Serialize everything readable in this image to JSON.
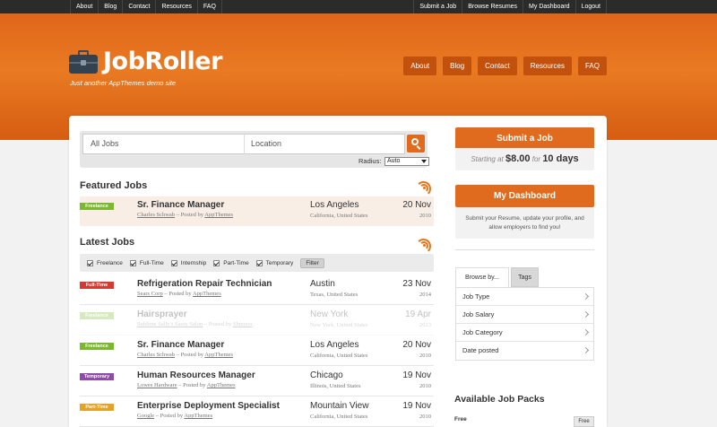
{
  "topbar": {
    "left_links": [
      "About",
      "Blog",
      "Contact",
      "Resources",
      "FAQ"
    ],
    "right_links": [
      "Submit a Job",
      "Browse Resumes",
      "My Dashboard",
      "Logout"
    ]
  },
  "header": {
    "logo_text": "JobRoller",
    "tagline": "Just another AppThemes demo site",
    "nav": [
      "About",
      "Blog",
      "Contact",
      "Resources",
      "FAQ"
    ]
  },
  "search": {
    "jobs_placeholder": "All Jobs",
    "location_placeholder": "Location",
    "radius_label": "Radius:",
    "radius_value": "Auto"
  },
  "featured": {
    "title": "Featured Jobs",
    "jobs": [
      {
        "badge": "Freelance",
        "badge_color": "#7cb82f",
        "title": "Sr. Finance Manager",
        "company": "Charles Schwab",
        "posted_prefix": " – Posted by ",
        "poster": "AppThemes",
        "location": "Los Angeles",
        "region": "California, United States",
        "date": "20 Nov",
        "year": "2010"
      }
    ]
  },
  "latest": {
    "title": "Latest Jobs",
    "filters": [
      "Freelance",
      "Full-Time",
      "Internship",
      "Part-Time",
      "Temporary"
    ],
    "filter_button": "Filter",
    "jobs": [
      {
        "badge": "Full-Time",
        "badge_color": "#d23a33",
        "title": "Refrigeration Repair Technician",
        "company": "Sears Corp",
        "posted_prefix": " – Posted by ",
        "poster": "AppThemes",
        "location": "Austin",
        "region": "Texas, United States",
        "date": "23 Nov",
        "year": "2014",
        "faded": false
      },
      {
        "badge": "Freelance",
        "badge_color": "#7cb82f",
        "title": "Hairsprayer",
        "company": "Sublime Sally's Sassy Salon",
        "posted_prefix": " – Posted by ",
        "poster": "Shmooo",
        "location": "New York",
        "region": "New York, United States",
        "date": "19 Apr",
        "year": "2013",
        "faded": true
      },
      {
        "badge": "Freelance",
        "badge_color": "#7cb82f",
        "title": "Sr. Finance Manager",
        "company": "Charles Schwab",
        "posted_prefix": " – Posted by ",
        "poster": "AppThemes",
        "location": "Los Angeles",
        "region": "California, United States",
        "date": "20 Nov",
        "year": "2010",
        "faded": false
      },
      {
        "badge": "Temporary",
        "badge_color": "#8e4ba8",
        "title": "Human Resources Manager",
        "company": "Lowes Hardware",
        "posted_prefix": " – Posted by ",
        "poster": "AppThemes",
        "location": "Chicago",
        "region": "Illinois, United States",
        "date": "19 Nov",
        "year": "2010",
        "faded": false
      },
      {
        "badge": "Part-Time",
        "badge_color": "#e3a32a",
        "title": "Enterprise Deployment Specialist",
        "company": "Google",
        "posted_prefix": " – Posted by ",
        "poster": "AppThemes",
        "location": "Mountain View",
        "region": "California, United States",
        "date": "19 Nov",
        "year": "2010",
        "faded": false
      }
    ]
  },
  "sidebar": {
    "submit_button": "Submit a Job",
    "starting_prefix": "Starting at ",
    "price": "$8.00",
    "for_text": " for ",
    "duration": "10 days",
    "dashboard_button": "My Dashboard",
    "dashboard_desc": "Submit your Resume, update your profile, and allow employers to find you!",
    "tabs": [
      "Browse by...",
      "Tags"
    ],
    "browse_items": [
      "Job Type",
      "Job Salary",
      "Job Category",
      "Date posted"
    ],
    "packs_title": "Available Job Packs",
    "pack_free": "Free",
    "pack_button": "Free"
  },
  "colors": {
    "accent": "#e06a1d",
    "topbar": "#2b2b2b"
  }
}
